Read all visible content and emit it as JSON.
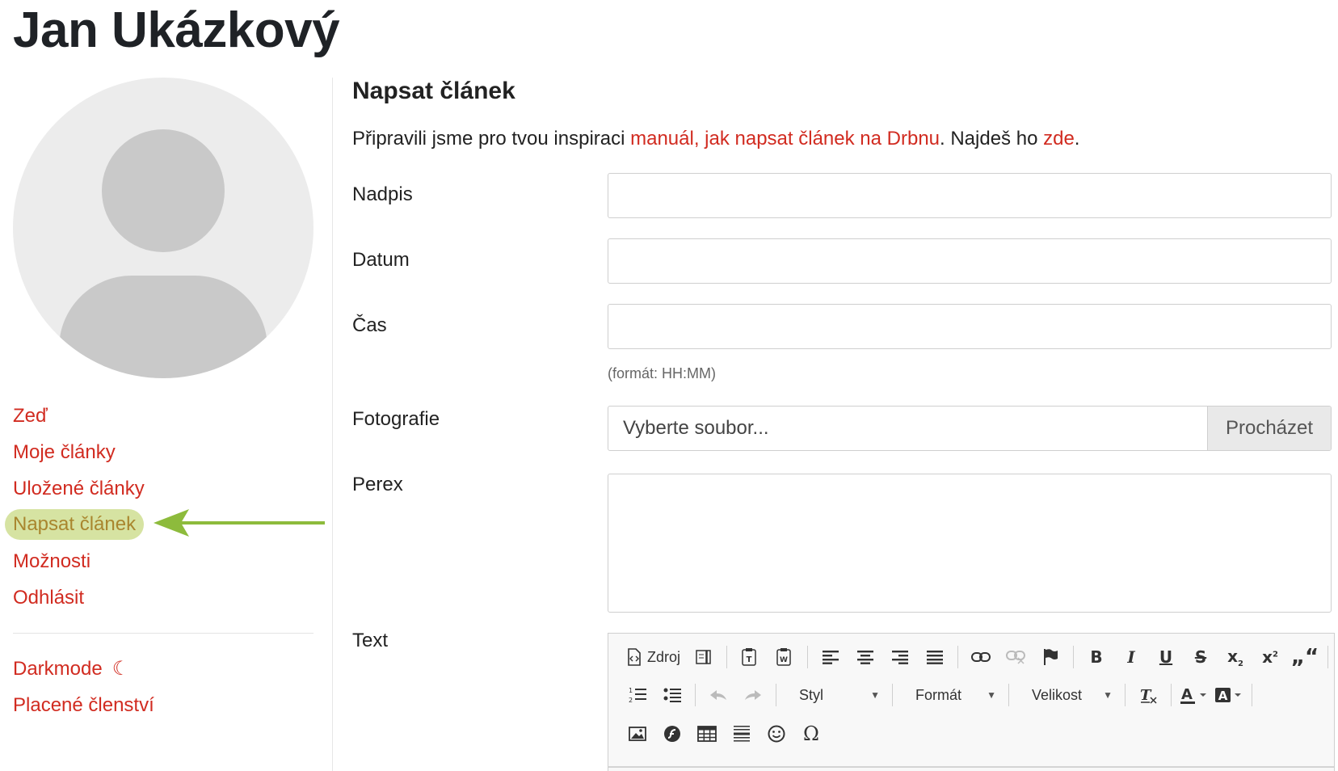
{
  "profile": {
    "name": "Jan Ukázkový"
  },
  "sidebar": {
    "items": [
      {
        "label": "Zeď"
      },
      {
        "label": "Moje články"
      },
      {
        "label": "Uložené články"
      },
      {
        "label": "Napsat článek",
        "active": true
      },
      {
        "label": "Možnosti"
      },
      {
        "label": "Odhlásit"
      }
    ],
    "secondary": [
      {
        "label": "Darkmode",
        "icon": "moon-icon"
      },
      {
        "label": "Placené členství"
      }
    ]
  },
  "main": {
    "title": "Napsat článek",
    "intro": {
      "prefix": "Připravili jsme pro tvou inspiraci ",
      "link1": "manuál, jak napsat článek na Drbnu",
      "middle": ". Najdeš ho ",
      "link2": "zde",
      "suffix": "."
    },
    "form": {
      "headline_label": "Nadpis",
      "date_label": "Datum",
      "time_label": "Čas",
      "time_hint": "(formát: HH:MM)",
      "photo_label": "Fotografie",
      "photo_placeholder": "Vyberte soubor...",
      "browse_label": "Procházet",
      "perex_label": "Perex",
      "text_label": "Text"
    },
    "editor": {
      "source_label": "Zdroj",
      "style_label": "Styl",
      "format_label": "Formát",
      "size_label": "Velikost"
    }
  },
  "colors": {
    "accent": "#d12b20",
    "active_bg": "#d6e3a2",
    "active_text": "#a9862e",
    "arrow": "#8dbb3c"
  }
}
